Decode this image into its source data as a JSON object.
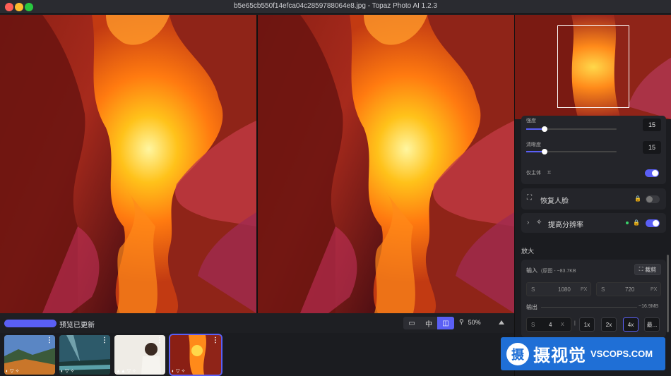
{
  "window": {
    "title": "b5e65cb550f14efca04c2859788064e8.jpg - Topaz Photo AI 1.2.3"
  },
  "status": {
    "text": "预览已更新",
    "progress": 1.0
  },
  "view_buttons": [
    {
      "name": "single-view",
      "label": "▭",
      "active": false
    },
    {
      "name": "split-view",
      "label": "中",
      "active": false
    },
    {
      "name": "side-by-side-view",
      "label": "◫",
      "active": true
    }
  ],
  "zoom": {
    "value": "50%"
  },
  "thumbnails": [
    {
      "menu": "⋮",
      "icons": "◐ ▽ ✧",
      "active": false
    },
    {
      "menu": "⋮",
      "icons": "◐ ▽ ✧",
      "active": false
    },
    {
      "menu": "⋮",
      "icons": "▲▲ ▽ ✧",
      "active": false
    },
    {
      "menu": "⋮",
      "icons": "◐ ▽ ✧",
      "active": true
    }
  ],
  "sidebar": {
    "strength": {
      "label": "强度",
      "value": "15",
      "level": 0.2
    },
    "clarity": {
      "label": "清晰度",
      "value": "15",
      "level": 0.2
    },
    "subject_only": {
      "label": "仅主体",
      "on": true
    },
    "recover_face": {
      "label": "恢复人脸",
      "on": false
    },
    "upscale": {
      "label": "提高分辨率",
      "on": true
    },
    "scale_section": "放大",
    "input": {
      "label": "输入",
      "note": "(原图 - ~83.7KB",
      "crop_label": "裁剪",
      "width_prefix": "S",
      "width": "1080",
      "width_unit": "PX",
      "height_prefix": "S",
      "height": "720",
      "height_unit": "PX"
    },
    "output": {
      "label": "输出",
      "size": "~16.9MB",
      "scale_prefix": "S",
      "scale_value": "4",
      "scale_unit": "X",
      "presets": [
        "1x",
        "2x",
        "4x",
        "最..."
      ],
      "active_preset": "4x"
    }
  },
  "watermark": {
    "logo_char": "摄",
    "cn": "摄视觉",
    "en": "VSCOPS.COM"
  },
  "colors": {
    "accent": "#5a5ff5",
    "status_dot": "#3ad16a"
  }
}
